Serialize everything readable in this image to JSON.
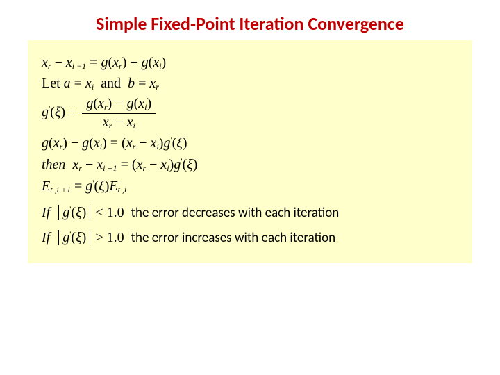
{
  "title": "Simple Fixed-Point Iteration Convergence",
  "eq1": {
    "a": "x",
    "as": "r",
    "b": "x",
    "bs": "i −1",
    "c": "g",
    "ca": "x",
    "cas": "r",
    "d": "g",
    "da": "x",
    "das": "i"
  },
  "eq2": {
    "pre": "Let",
    "a": "a",
    "av": "x",
    "avs": "i",
    "b": "b",
    "bv": "x",
    "bvs": "r"
  },
  "eq3": {
    "g": "g",
    "gp": "'",
    "xi": "ξ",
    "n1": "g",
    "n1a": "x",
    "n1as": "r",
    "n2": "g",
    "n2a": "x",
    "n2as": "i",
    "d1": "x",
    "d1s": "r",
    "d2": "x",
    "d2s": "i"
  },
  "eq4": {
    "g1": "g",
    "g1a": "x",
    "g1as": "r",
    "g2": "g",
    "g2a": "x",
    "g2as": "i",
    "p1": "x",
    "p1s": "r",
    "p2": "x",
    "p2s": "i",
    "gp": "'",
    "xi": "ξ"
  },
  "eq5": {
    "pre": "then",
    "a": "x",
    "as": "r",
    "b": "x",
    "bs": "i +1",
    "p1": "x",
    "p1s": "r",
    "p2": "x",
    "p2s": "i",
    "g": "g",
    "gp": "'",
    "xi": "ξ"
  },
  "eq6": {
    "E": "E",
    "s1": "t ,i +1",
    "g": "g",
    "gp": "'",
    "xi": "ξ",
    "E2": "E",
    "s2": "t ,i"
  },
  "cond1": {
    "pre": "If",
    "g": "g",
    "gp": "'",
    "xi": "ξ",
    "cmp": "< 1.0",
    "txt": "the error decreases with each iteration"
  },
  "cond2": {
    "pre": "If",
    "g": "g",
    "gp": "'",
    "xi": "ξ",
    "cmp": "> 1.0",
    "txt": "the error increases with each iteration"
  }
}
